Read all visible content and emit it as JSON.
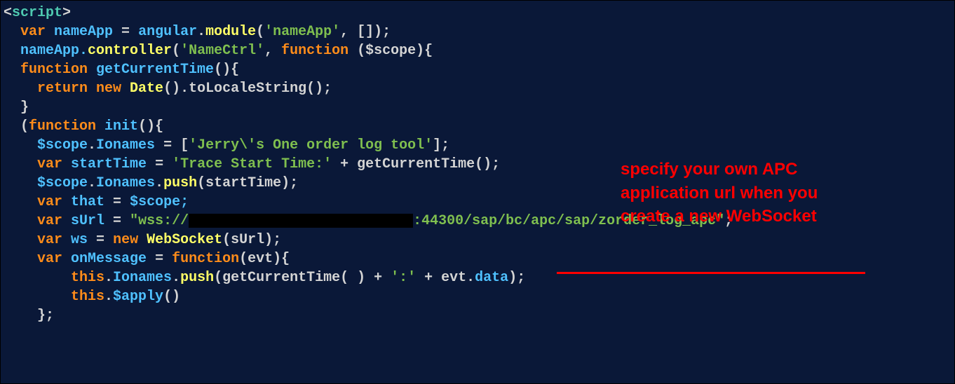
{
  "code": {
    "line01": {
      "open_angle": "<",
      "tag": "script",
      "close_angle": ">"
    },
    "line02": {
      "kw": "var",
      "ident": " nameApp",
      "op": " = ",
      "obj": "angular",
      "dot": ".",
      "method": "module",
      "paren_open": "(",
      "str": "'nameApp'",
      "comma": ", []",
      "paren_close": ");"
    },
    "line03": {
      "ident": "nameApp.",
      "method": "controller",
      "paren_open": "(",
      "str": "'NameCtrl'",
      "comma": ", ",
      "kw": "function",
      "params": " ($scope){"
    },
    "line04": {
      "kw": "function",
      "ident": " getCurrentTime",
      "params": "(){"
    },
    "line05": {
      "kw1": "return",
      "kw2": " new",
      "type": " Date",
      "call": "().toLocaleString();"
    },
    "line06": {
      "txt": "}"
    },
    "line07": {
      "paren": "(",
      "kw": "function",
      "ident": " init",
      "params": "(){"
    },
    "line08": {
      "obj": "$scope",
      "dot": ".",
      "prop": "Ionames",
      "op": " = [",
      "str": "'Jerry\\'s One order log tool'",
      "close": "];"
    },
    "line09": {
      "kw": "var",
      "ident": " startTime",
      "op": " = ",
      "str": "'Trace Start Time:'",
      "plus": " + getCurrentTime();"
    },
    "line10": {
      "obj": "$scope",
      "dot": ".",
      "prop": "Ionames",
      "dot2": ".",
      "method": "push",
      "args": "(startTime);"
    },
    "line11": {
      "kw": "var",
      "ident": " that",
      "op": " = ",
      "val": "$scope;"
    },
    "line12": {
      "kw": "var",
      "ident": " sUrl",
      "op": " = ",
      "str1": "\"wss://",
      "str2": ":44300/sap/bc/apc/sap/zorder_log_apc\"",
      "semi": ";"
    },
    "line13": {
      "kw": "var",
      "ident": " ws",
      "op": " = ",
      "kw2": "new",
      "type": " WebSocket",
      "args": "(sUrl);"
    },
    "line14": {
      "kw": "var",
      "ident": " onMessage",
      "op": " = ",
      "kw2": "function",
      "args": "(evt){"
    },
    "line15": {
      "kw": "this",
      "dot": ".",
      "prop": "Ionames",
      "dot2": ".",
      "method": "push",
      "open": "(getCurrentTime( ) + ",
      "str": "':'",
      "plus": " + evt.",
      "prop2": "data",
      "close": ");"
    },
    "line16": {
      "kw": "this",
      "dot": ".",
      "method": "$apply",
      "args": "()"
    },
    "line17": {
      "txt": "};"
    }
  },
  "annotation": {
    "line1": "specify your own APC",
    "line2": "application url when you",
    "line3": "create a new WebSocket"
  }
}
